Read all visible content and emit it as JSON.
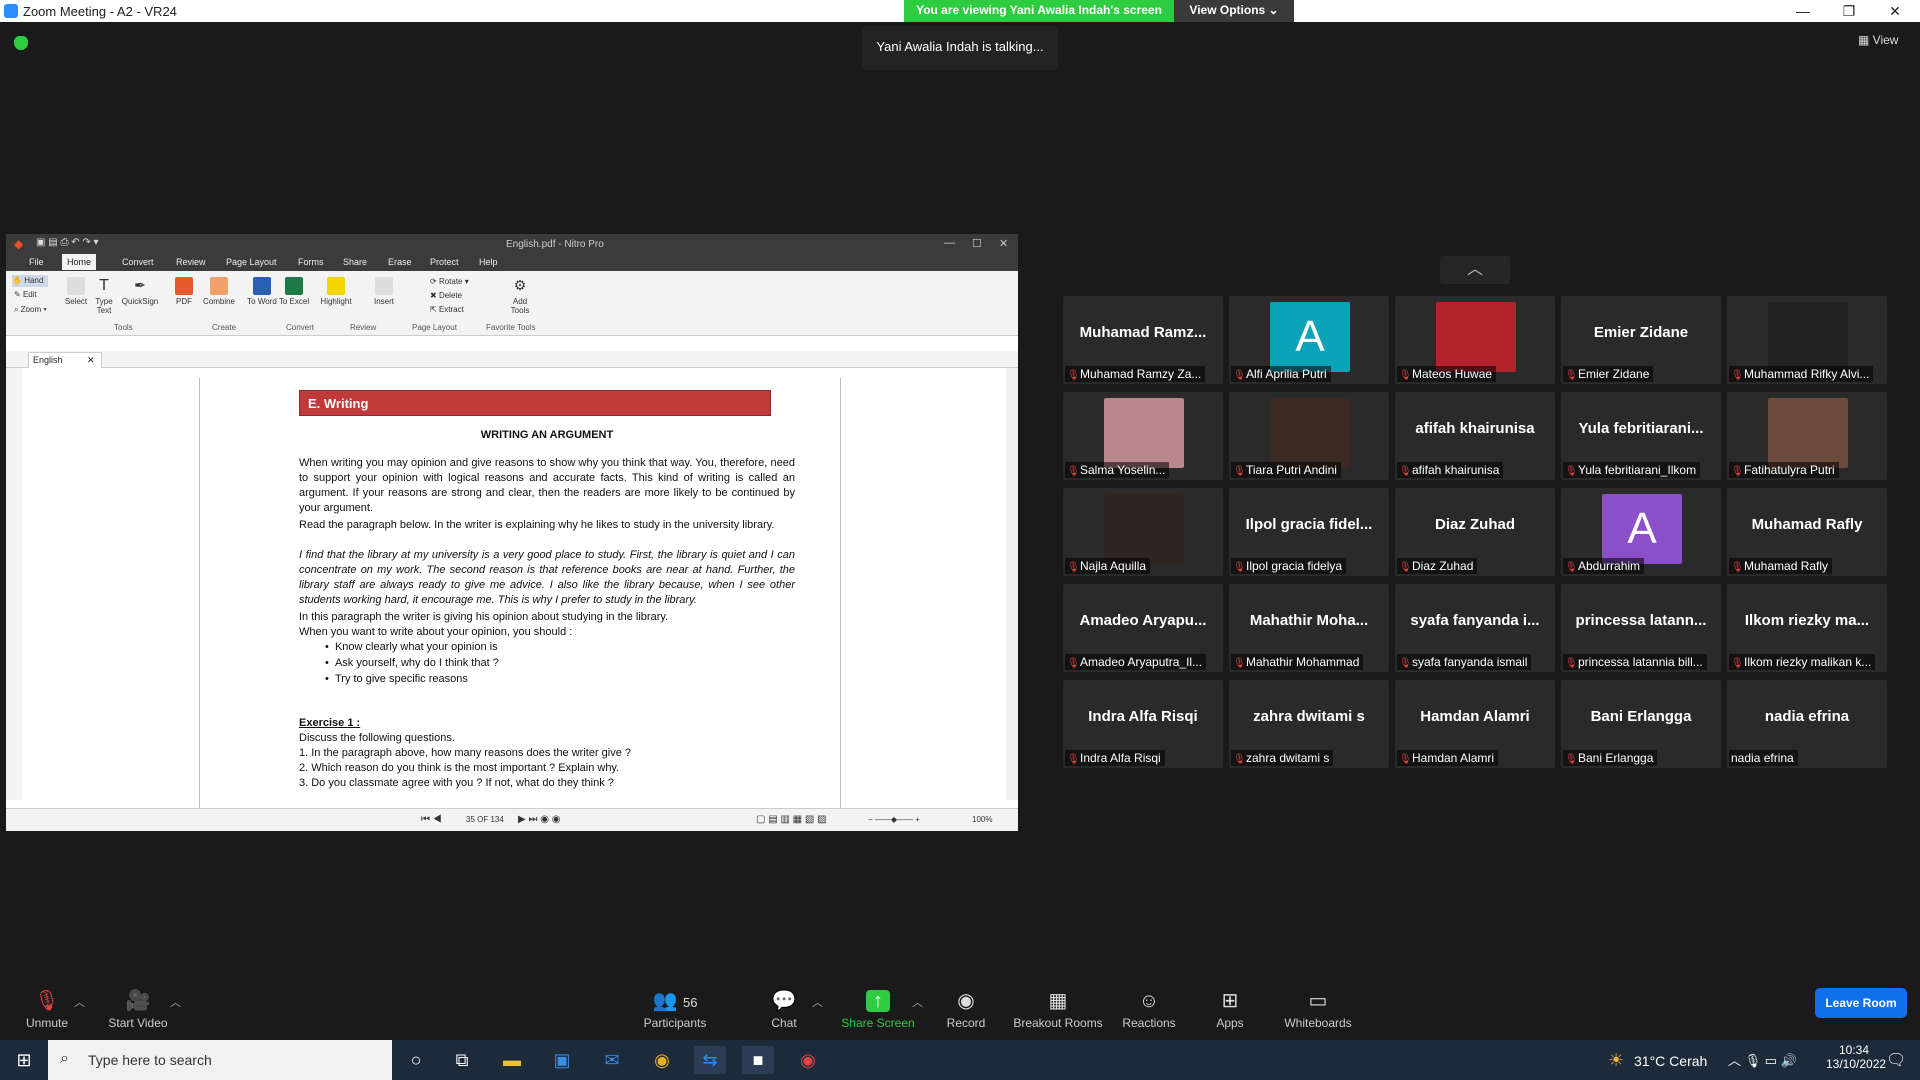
{
  "window": {
    "title": "Zoom Meeting - A2 - VR24",
    "minimize": "—",
    "maximize": "❐",
    "close": "✕"
  },
  "banner": {
    "viewing": "You are viewing Yani Awalia Indah's screen",
    "view_options": "View Options ⌄"
  },
  "talking": "Yani Awalia Indah is talking...",
  "view_button": "▦ View",
  "doc": {
    "window_title": "English.pdf - Nitro Pro",
    "menu": [
      "File",
      "Home",
      "Convert",
      "Review",
      "Page Layout",
      "Forms",
      "Share",
      "Erase",
      "Protect",
      "Help"
    ],
    "tools": {
      "hand": "Hand",
      "edit": "Edit",
      "zoom": "Zoom"
    },
    "ribbon_buttons": [
      "Select",
      "Type Text",
      "QuickSign",
      "PDF",
      "Combine",
      "To Word",
      "To Excel",
      "Highlight",
      "Insert",
      "Rotate",
      "Delete",
      "Extract",
      "Add Tools"
    ],
    "groups": [
      "Tools",
      "Create",
      "Convert",
      "Review",
      "Page Layout",
      "Favorite Tools"
    ],
    "tab": "English",
    "status": {
      "page": "35 OF 134",
      "zoom": "100%"
    },
    "content": {
      "section": "E. Writing",
      "heading": "WRITING AN ARGUMENT",
      "p1": "When writing you may opinion and give reasons to show why you think that way. You, therefore, need to support your opinion with logical reasons and accurate facts. This kind of writing is called an argument. If your reasons are strong and clear, then the readers are more likely to be continued by your argument.",
      "p2": "Read the paragraph below. In the writer is explaining why he likes to study in the university library.",
      "p3": "I find that the library at my university is a very good place to study. First, the library is quiet and I can concentrate on my work. The second reason is that reference books are near at hand. Further, the library staff are always ready to give me advice. I also like the library because, when I see other students working hard, it encourage me. This is why I prefer to study in the library.",
      "p4": "In this paragraph the writer is giving his opinion about studying in the library.",
      "p5": "When you want to write about your opinion, you should :",
      "bullets": [
        "Know clearly what your opinion is",
        "Ask yourself, why do I think that ?",
        "Try to give specific reasons"
      ],
      "exercise": "Exercise 1 :",
      "exercise_intro": "Discuss the following questions.",
      "questions": [
        "1.   In the paragraph above, how many reasons does the writer give ?",
        "2.   Which reason do you think is the most important ? Explain why.",
        "3.   Do you classmate agree with you ? If not, what do they think ?"
      ]
    }
  },
  "participants": [
    {
      "big": "Muhamad  Ramz...",
      "label": "Muhamad Ramzy Za..."
    },
    {
      "big": "",
      "label": "Alfi Aprilia Putri",
      "letter": "A",
      "color": "#0aa3b8"
    },
    {
      "big": "",
      "label": "Mateos Huwae",
      "photo": "car"
    },
    {
      "big": "Emier Zidane",
      "label": "Emier Zidane"
    },
    {
      "big": "",
      "label": "Muhammad Rifky Alvi...",
      "photo": "dark"
    },
    {
      "big": "",
      "label": "Salma Yoselin...",
      "photo": "sunset"
    },
    {
      "big": "",
      "label": "Tiara Putri Andini",
      "photo": "face"
    },
    {
      "big": "afifah khairunisa",
      "label": "afifah khairunisa"
    },
    {
      "big": "Yula  febritiarani...",
      "label": "Yula febritiarani_Ilkom"
    },
    {
      "big": "",
      "label": "Fatihatulyra Putri",
      "photo": "face2"
    },
    {
      "big": "",
      "label": "Najla Aquilla",
      "photo": "face3"
    },
    {
      "big": "Ilpol  gracia  fidel...",
      "label": "Ilpol gracia fidelya"
    },
    {
      "big": "Diaz Zuhad",
      "label": "Diaz Zuhad"
    },
    {
      "big": "",
      "label": "Abdurrahim",
      "letter": "A",
      "color": "#8a4fc9"
    },
    {
      "big": "Muhamad Rafly",
      "label": "Muhamad Rafly"
    },
    {
      "big": "Amadeo  Aryapu...",
      "label": "Amadeo Aryaputra_Il..."
    },
    {
      "big": "Mahathir  Moha...",
      "label": "Mahathir Mohammad"
    },
    {
      "big": "syafa  fanyanda  i...",
      "label": "syafa fanyanda ismail"
    },
    {
      "big": "princessa  latann...",
      "label": "princessa latannia bill..."
    },
    {
      "big": "Ilkom  riezky  ma...",
      "label": "Ilkom riezky malikan k..."
    },
    {
      "big": "Indra Alfa Risqi",
      "label": "Indra Alfa Risqi"
    },
    {
      "big": "zahra dwitami s",
      "label": "zahra dwitami s"
    },
    {
      "big": "Hamdan Alamri",
      "label": "Hamdan Alamri"
    },
    {
      "big": "Bani Erlangga",
      "label": "Bani Erlangga"
    },
    {
      "big": "nadia efrina",
      "label": "nadia efrina",
      "unmuted": true
    }
  ],
  "toolbar": {
    "unmute": "Unmute",
    "start_video": "Start Video",
    "participants_count": "56",
    "participants": "Participants",
    "chat": "Chat",
    "share_screen": "Share Screen",
    "record": "Record",
    "breakout": "Breakout Rooms",
    "reactions": "Reactions",
    "apps": "Apps",
    "whiteboards": "Whiteboards",
    "leave": "Leave Room"
  },
  "taskbar": {
    "search_placeholder": "Type here to search",
    "weather": "31°C  Cerah",
    "time": "10:34",
    "date": "13/10/2022"
  }
}
